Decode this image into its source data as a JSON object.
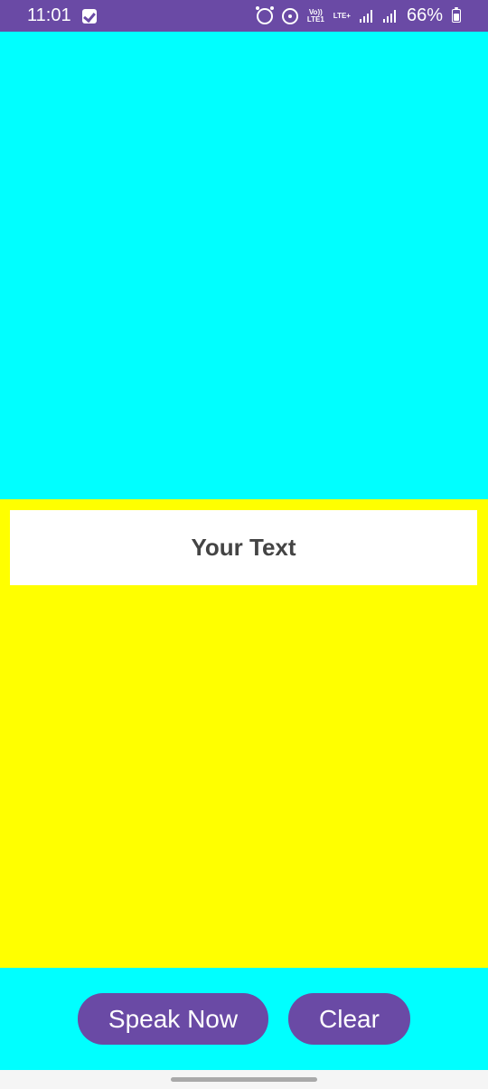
{
  "status_bar": {
    "time": "11:01",
    "battery": "66%",
    "volte_top": "Vo))",
    "volte_bottom": "LTE1",
    "lte": "LTE+"
  },
  "main": {
    "text_display": "Your Text"
  },
  "buttons": {
    "speak": "Speak Now",
    "clear": "Clear"
  },
  "colors": {
    "accent": "#6a4aa5",
    "top_bg": "#00ffff",
    "middle_bg": "#ffff00",
    "text_box_bg": "#ffffff"
  }
}
